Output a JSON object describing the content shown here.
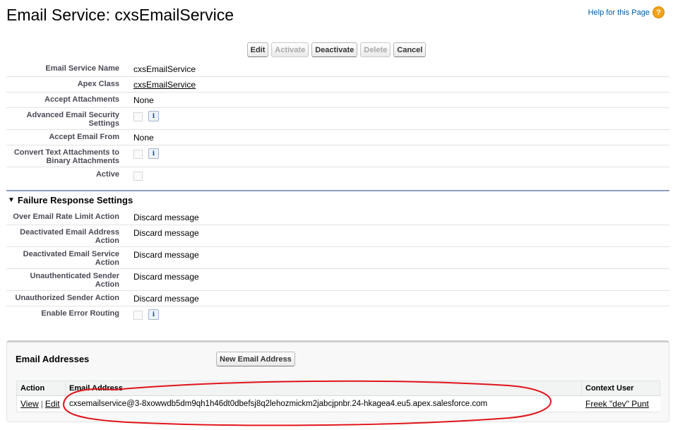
{
  "header": {
    "title": "Email Service: cxsEmailService",
    "help_link": "Help for this Page",
    "help_icon": "?"
  },
  "toolbar": {
    "edit": "Edit",
    "activate": "Activate",
    "deactivate": "Deactivate",
    "delete": "Delete",
    "cancel": "Cancel"
  },
  "details": {
    "email_service_name": {
      "label": "Email Service Name",
      "value": "cxsEmailService"
    },
    "apex_class": {
      "label": "Apex Class",
      "value": "cxsEmailService"
    },
    "accept_attachments": {
      "label": "Accept Attachments",
      "value": "None"
    },
    "advanced_security": {
      "label": "Advanced Email Security Settings",
      "checked": false
    },
    "accept_email_from": {
      "label": "Accept Email From",
      "value": "None"
    },
    "convert_text": {
      "label": "Convert Text Attachments to Binary Attachments",
      "checked": false
    },
    "active": {
      "label": "Active",
      "checked": false
    }
  },
  "failure_section": {
    "title": "Failure Response Settings",
    "over_rate": {
      "label": "Over Email Rate Limit Action",
      "value": "Discard message"
    },
    "deactivated_address": {
      "label": "Deactivated Email Address Action",
      "value": "Discard message"
    },
    "deactivated_service": {
      "label": "Deactivated Email Service Action",
      "value": "Discard message"
    },
    "unauthenticated": {
      "label": "Unauthenticated Sender Action",
      "value": "Discard message"
    },
    "unauthorized": {
      "label": "Unauthorized Sender Action",
      "value": "Discard message"
    },
    "error_routing": {
      "label": "Enable Error Routing",
      "checked": false
    }
  },
  "email_addresses": {
    "title": "Email Addresses",
    "new_button": "New Email Address",
    "columns": [
      "Action",
      "Email Address",
      "Context User"
    ],
    "rows": [
      {
        "view": "View",
        "separator": "|",
        "edit": "Edit",
        "address": "cxsemailservice@3-8xowwdb5dm9qh1h46dt0dbefsj8q2lehozmickm2jabcjpnbr.24-hkagea4.eu5.apex.salesforce.com",
        "context_user": "Freek \"dev\" Punt"
      }
    ]
  },
  "colors": {
    "annotation": "#e0151b",
    "section_rule": "#8e9dbe",
    "help_link": "#015ba7"
  }
}
